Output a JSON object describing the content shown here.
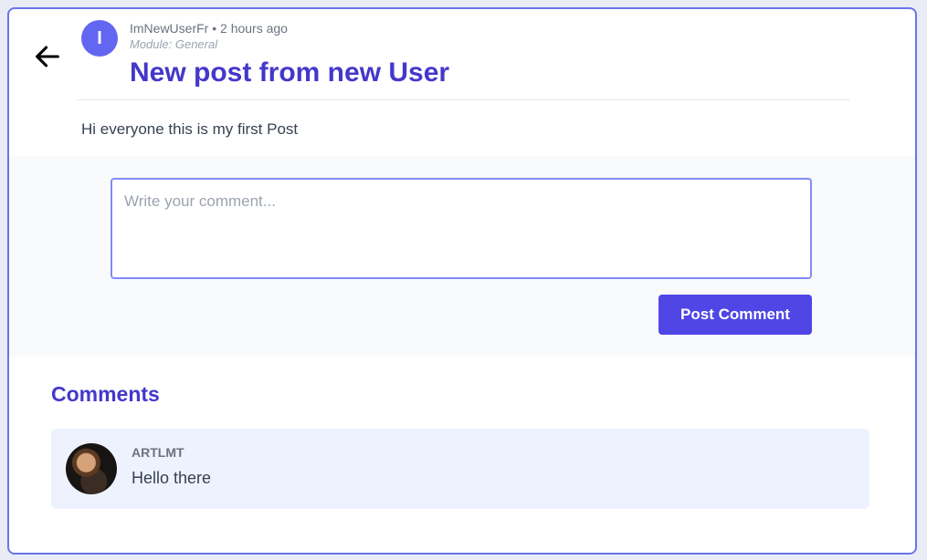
{
  "post": {
    "author_initial": "I",
    "meta": "ImNewUserFr • 2 hours ago",
    "module": "Module: General",
    "title": "New post from new User",
    "body": "Hi everyone this is my first Post"
  },
  "comment_form": {
    "placeholder": "Write your comment...",
    "value": "",
    "submit_label": "Post Comment"
  },
  "comments": {
    "heading": "Comments",
    "items": [
      {
        "author": "ARTLMT",
        "text": "Hello there"
      }
    ]
  },
  "colors": {
    "accent": "#4f46e5",
    "title": "#4338ca",
    "border": "#6b73e8",
    "avatar_bg": "#6366f1",
    "comment_bg": "#eef2ff"
  },
  "icons": {
    "back": "arrow-left-icon"
  }
}
